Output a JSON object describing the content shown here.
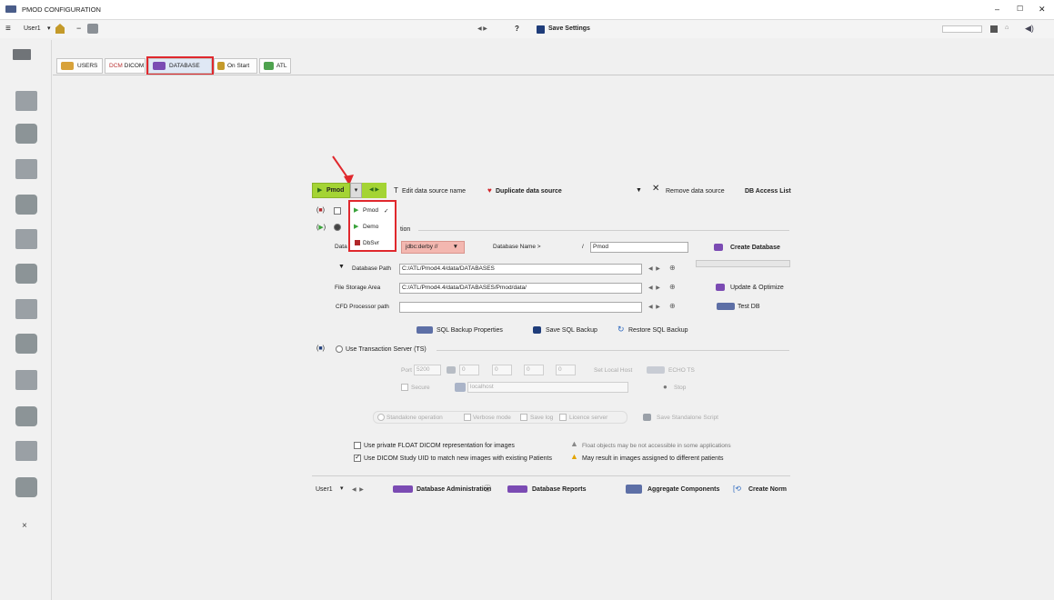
{
  "window": {
    "title": "PMOD CONFIGURATION",
    "min": "–",
    "max": "☐",
    "close": "✕"
  },
  "toolbar": {
    "user": "User1",
    "save_settings": "Save Settings",
    "help": "?"
  },
  "tabs": [
    {
      "label": "USERS"
    },
    {
      "label": "DICOM",
      "prefix": "DCM"
    },
    {
      "label": "DATABASE"
    },
    {
      "label": "On Start"
    },
    {
      "label": "ATL"
    }
  ],
  "datasource": {
    "selected": "Pmod",
    "edit_name": "Edit data source name",
    "duplicate": "Duplicate data source",
    "remove": "Remove data source",
    "access_list": "DB Access List",
    "menu": [
      {
        "label": "Pmod",
        "check": "✓",
        "color": "#3aa23a"
      },
      {
        "label": "Demo",
        "check": "",
        "color": "#3aa23a"
      },
      {
        "label": "DbSvr",
        "check": "",
        "color": "#b1272a"
      }
    ]
  },
  "db": {
    "section_suffix": "tion",
    "db_label_prefix": "Data",
    "jdbc_value": "jdbc:derby //",
    "db_name_label": "Database Name >",
    "slash": "/",
    "db_name_value": "Pmod",
    "create": "Create Database",
    "path_label": "Database Path",
    "path_value": "C:/ATL/Pmod4.4/data/DATABASES",
    "storage_label": "File Storage Area",
    "storage_value": "C:/ATL/Pmod4.4/data/DATABASES/Pmod/data/",
    "update": "Update & Optimize",
    "cfd_label": "CFD Processor path",
    "cfd_value": "",
    "test": "Test DB",
    "sql_props": "SQL Backup Properties",
    "save_backup": "Save SQL Backup",
    "restore_backup": "Restore SQL Backup"
  },
  "ts": {
    "label": "Use Transaction Server (TS)",
    "port_label": "Port",
    "port_value": "5200",
    "ip": [
      "0",
      "0",
      "0",
      "0"
    ],
    "set_local": "Set Local Host",
    "echo": "ECHO TS",
    "secure": "Secure",
    "host_value": "localhost",
    "stop": "Stop",
    "standalone": "Standalone operation",
    "verbose": "Verbose mode",
    "save_log": "Save log",
    "license": "Licence server",
    "save_script": "Save Standalone Script"
  },
  "options": {
    "float_label": "Use private FLOAT DICOM representation for images",
    "float_warning": "Float objects may be not accessible in some applications",
    "uid_label": "Use DICOM Study UID to match new images with existing Patients",
    "uid_warning": "May result in images assigned to different patients"
  },
  "bottom": {
    "user": "User1",
    "admin": "Database Administration",
    "reports": "Database Reports",
    "aggregate": "Aggregate Components",
    "norm": "Create Norm"
  },
  "colors": {
    "green": "#a4d434",
    "red_outline": "#e0282d",
    "pink": "#f3b7b0"
  }
}
